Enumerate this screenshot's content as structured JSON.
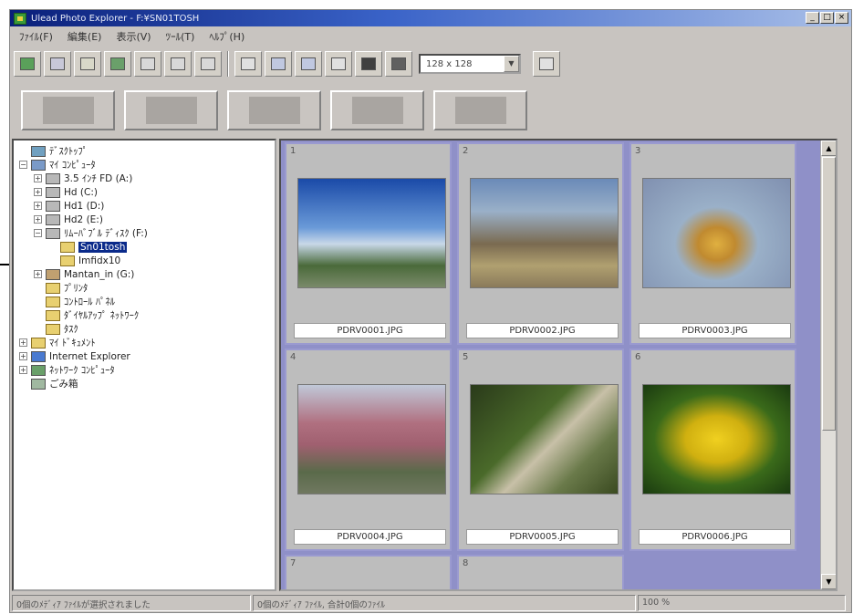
{
  "window": {
    "title": "Ulead Photo Explorer - F:¥SN01TOSH",
    "controls": [
      "_",
      "□",
      "×"
    ]
  },
  "menu": [
    "ﾌｧｲﾙ(F)",
    "編集(E)",
    "表示(V)",
    "ﾂｰﾙ(T)",
    "ﾍﾙﾌﾟ(H)"
  ],
  "toolbar": {
    "thumb_size": "128 x 128",
    "dropdown_arrow": "▼"
  },
  "tree": {
    "items": [
      {
        "label": "ﾃﾞｽｸﾄｯﾌﾟ",
        "icon": "desktop-icon",
        "indent": 0,
        "expander": ""
      },
      {
        "label": "ﾏｲ ｺﾝﾋﾟｭｰﾀ",
        "icon": "computer-icon",
        "indent": 0,
        "expander": "−"
      },
      {
        "label": "3.5 ｲﾝﾁ FD (A:)",
        "icon": "floppy-icon",
        "indent": 1,
        "expander": "+"
      },
      {
        "label": "Hd (C:)",
        "icon": "drive-icon",
        "indent": 1,
        "expander": "+"
      },
      {
        "label": "Hd1 (D:)",
        "icon": "drive-icon",
        "indent": 1,
        "expander": "+"
      },
      {
        "label": "Hd2 (E:)",
        "icon": "drive-icon",
        "indent": 1,
        "expander": "+"
      },
      {
        "label": "ﾘﾑｰﾊﾞﾌﾞﾙ ﾃﾞｨｽｸ (F:)",
        "icon": "removable-disk-icon",
        "indent": 1,
        "expander": "−"
      },
      {
        "label": "Sn01tosh",
        "icon": "folder-open-icon",
        "indent": 2,
        "expander": "",
        "selected": true
      },
      {
        "label": "Imfidx10",
        "icon": "folder-icon",
        "indent": 2,
        "expander": ""
      },
      {
        "label": "Mantan_in (G:)",
        "icon": "cdrom-icon",
        "indent": 1,
        "expander": "+"
      },
      {
        "label": "ﾌﾟﾘﾝﾀ",
        "icon": "printer-folder-icon",
        "indent": 1,
        "expander": ""
      },
      {
        "label": "ｺﾝﾄﾛｰﾙ ﾊﾟﾈﾙ",
        "icon": "control-panel-icon",
        "indent": 1,
        "expander": ""
      },
      {
        "label": "ﾀﾞｲﾔﾙｱｯﾌﾟ ﾈｯﾄﾜｰｸ",
        "icon": "dialup-icon",
        "indent": 1,
        "expander": ""
      },
      {
        "label": "ﾀｽｸ",
        "icon": "task-icon",
        "indent": 1,
        "expander": ""
      },
      {
        "label": "ﾏｲ ﾄﾞｷｭﾒﾝﾄ",
        "icon": "my-documents-icon",
        "indent": 0,
        "expander": "+"
      },
      {
        "label": "Internet Explorer",
        "icon": "ie-icon",
        "indent": 0,
        "expander": "+"
      },
      {
        "label": "ﾈｯﾄﾜｰｸ ｺﾝﾋﾟｭｰﾀ",
        "icon": "network-icon",
        "indent": 0,
        "expander": "+"
      },
      {
        "label": "ごみ箱",
        "icon": "recycle-bin-icon",
        "indent": 0,
        "expander": ""
      }
    ]
  },
  "thumbnails": [
    {
      "num": "1",
      "file": "PDRV0001.JPG",
      "scene": "sky-tree"
    },
    {
      "num": "2",
      "file": "PDRV0002.JPG",
      "scene": "city-park"
    },
    {
      "num": "3",
      "file": "PDRV0003.JPG",
      "scene": "dog-statue"
    },
    {
      "num": "4",
      "file": "PDRV0004.JPG",
      "scene": "blossom-tree"
    },
    {
      "num": "5",
      "file": "PDRV0005.JPG",
      "scene": "garden-steps"
    },
    {
      "num": "6",
      "file": "PDRV0006.JPG",
      "scene": "yellow-flowers"
    },
    {
      "num": "7",
      "file": "",
      "scene": ""
    },
    {
      "num": "8",
      "file": "",
      "scene": ""
    }
  ],
  "status": {
    "left": "0個のﾒﾃﾞｨｱ ﾌｧｲﾙが選択されました",
    "middle": "0個のﾒﾃﾞｨｱ ﾌｧｲﾙ, 合計0個のﾌｧｲﾙ",
    "right": "100 %"
  },
  "colors": {
    "titlebar_start": "#0a1f7a",
    "thumb_bg": "#8f90c8",
    "selection": "#0a2a8a"
  }
}
